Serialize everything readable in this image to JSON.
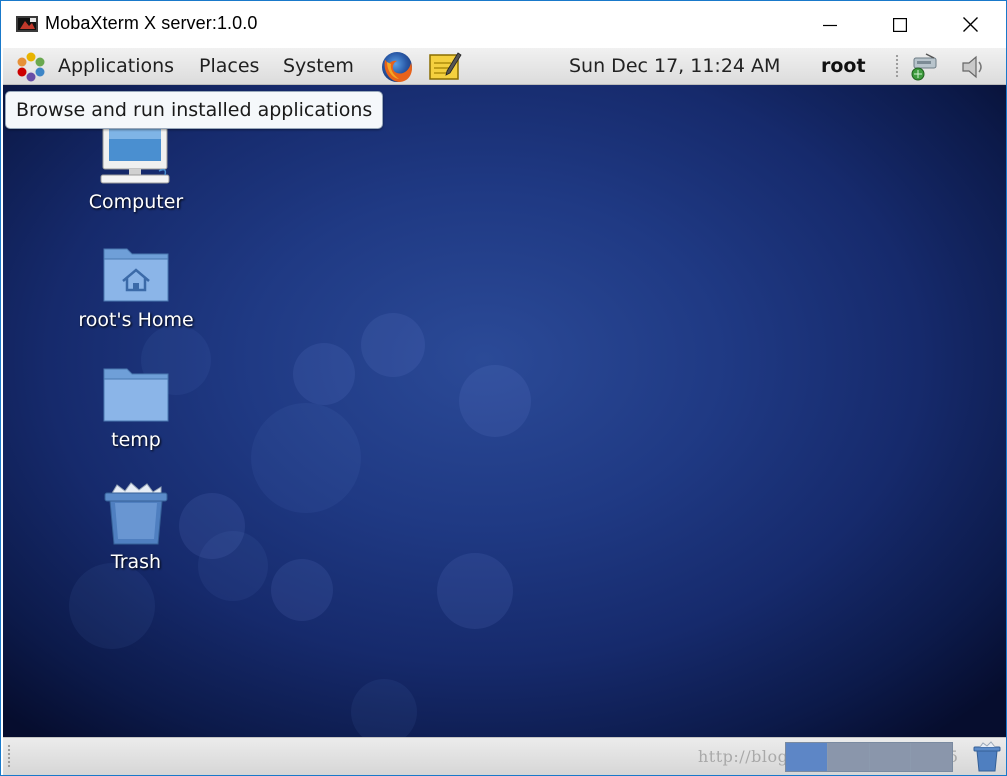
{
  "window": {
    "title": "MobaXterm X server:1.0.0"
  },
  "panel": {
    "menus": [
      "Applications",
      "Places",
      "System"
    ],
    "clock": "Sun Dec 17, 11:24 AM",
    "user": "root",
    "launchers": [
      "firefox-icon",
      "text-editor-icon"
    ],
    "tray": [
      "network-icon",
      "volume-icon"
    ]
  },
  "tooltip": {
    "text": "Browse and run installed applications"
  },
  "desktop": {
    "icons": [
      {
        "label": "Computer",
        "icon": "computer-icon"
      },
      {
        "label": "root's Home",
        "icon": "home-folder-icon"
      },
      {
        "label": "temp",
        "icon": "folder-icon"
      },
      {
        "label": "Trash",
        "icon": "trash-icon"
      }
    ]
  },
  "bottom_panel": {
    "workspace_count": 4,
    "active_workspace": 1,
    "watermark": "http://blog.csdn.net/fuyi42015"
  },
  "colors": {
    "window_border": "#1979ca",
    "desktop_center": "#2b4a97",
    "desktop_edge": "#060d2e",
    "workspace_active": "#5d86c6"
  }
}
